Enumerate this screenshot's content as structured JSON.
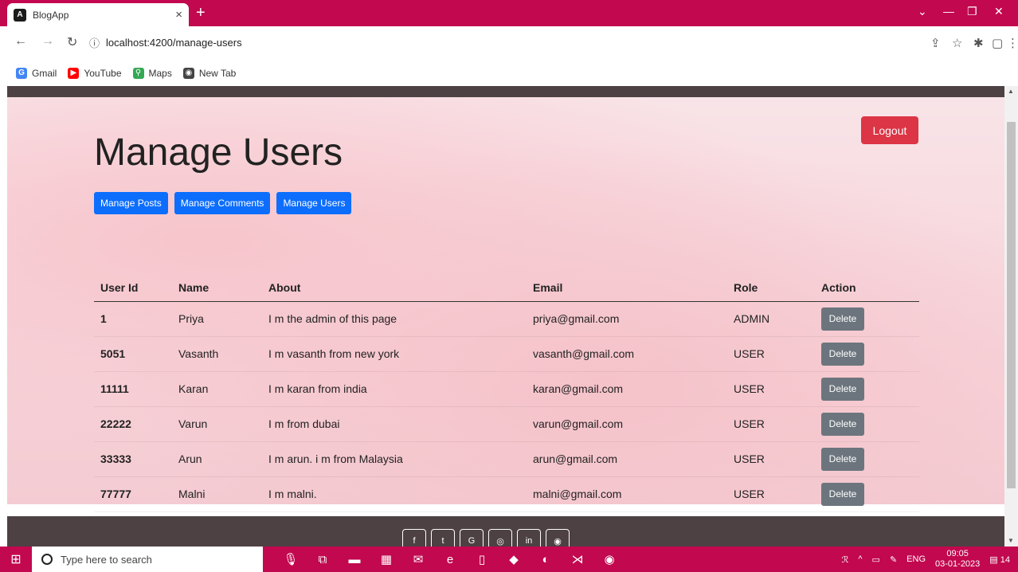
{
  "browser": {
    "tab_title": "BlogApp",
    "tab_close": "×",
    "new_tab": "+",
    "url_info": "ⓘ",
    "url": "localhost:4200/manage-users",
    "bookmarks": [
      {
        "label": "Gmail",
        "icon": "G",
        "color": "#4285f4"
      },
      {
        "label": "YouTube",
        "icon": "▶",
        "color": "#ff0000"
      },
      {
        "label": "Maps",
        "icon": "⚲",
        "color": "#34a853"
      },
      {
        "label": "New Tab",
        "icon": "◉",
        "color": "#444444"
      }
    ]
  },
  "page": {
    "title": "Manage Users",
    "logout_label": "Logout",
    "nav": {
      "posts": "Manage Posts",
      "comments": "Manage Comments",
      "users": "Manage Users"
    },
    "table": {
      "headers": [
        "User Id",
        "Name",
        "About",
        "Email",
        "Role",
        "Action"
      ],
      "delete_label": "Delete",
      "rows": [
        {
          "id": "1",
          "name": "Priya",
          "about": "I m the admin of this page",
          "email": "priya@gmail.com",
          "role": "ADMIN"
        },
        {
          "id": "5051",
          "name": "Vasanth",
          "about": "I m vasanth from new york",
          "email": "vasanth@gmail.com",
          "role": "USER"
        },
        {
          "id": "11111",
          "name": "Karan",
          "about": "I m karan from india",
          "email": "karan@gmail.com",
          "role": "USER"
        },
        {
          "id": "22222",
          "name": "Varun",
          "about": "I m from dubai",
          "email": "varun@gmail.com",
          "role": "USER"
        },
        {
          "id": "33333",
          "name": "Arun",
          "about": "I m arun. i m from Malaysia",
          "email": "arun@gmail.com",
          "role": "USER"
        },
        {
          "id": "77777",
          "name": "Malni",
          "about": "I m malni.",
          "email": "malni@gmail.com",
          "role": "USER"
        }
      ]
    },
    "footer_social": [
      "f",
      "t",
      "G",
      "◎",
      "in",
      "◉"
    ]
  },
  "taskbar": {
    "search_placeholder": "Type here to search",
    "language": "ENG",
    "time": "09:05",
    "date": "03-01-2023",
    "notification_count": "14"
  }
}
